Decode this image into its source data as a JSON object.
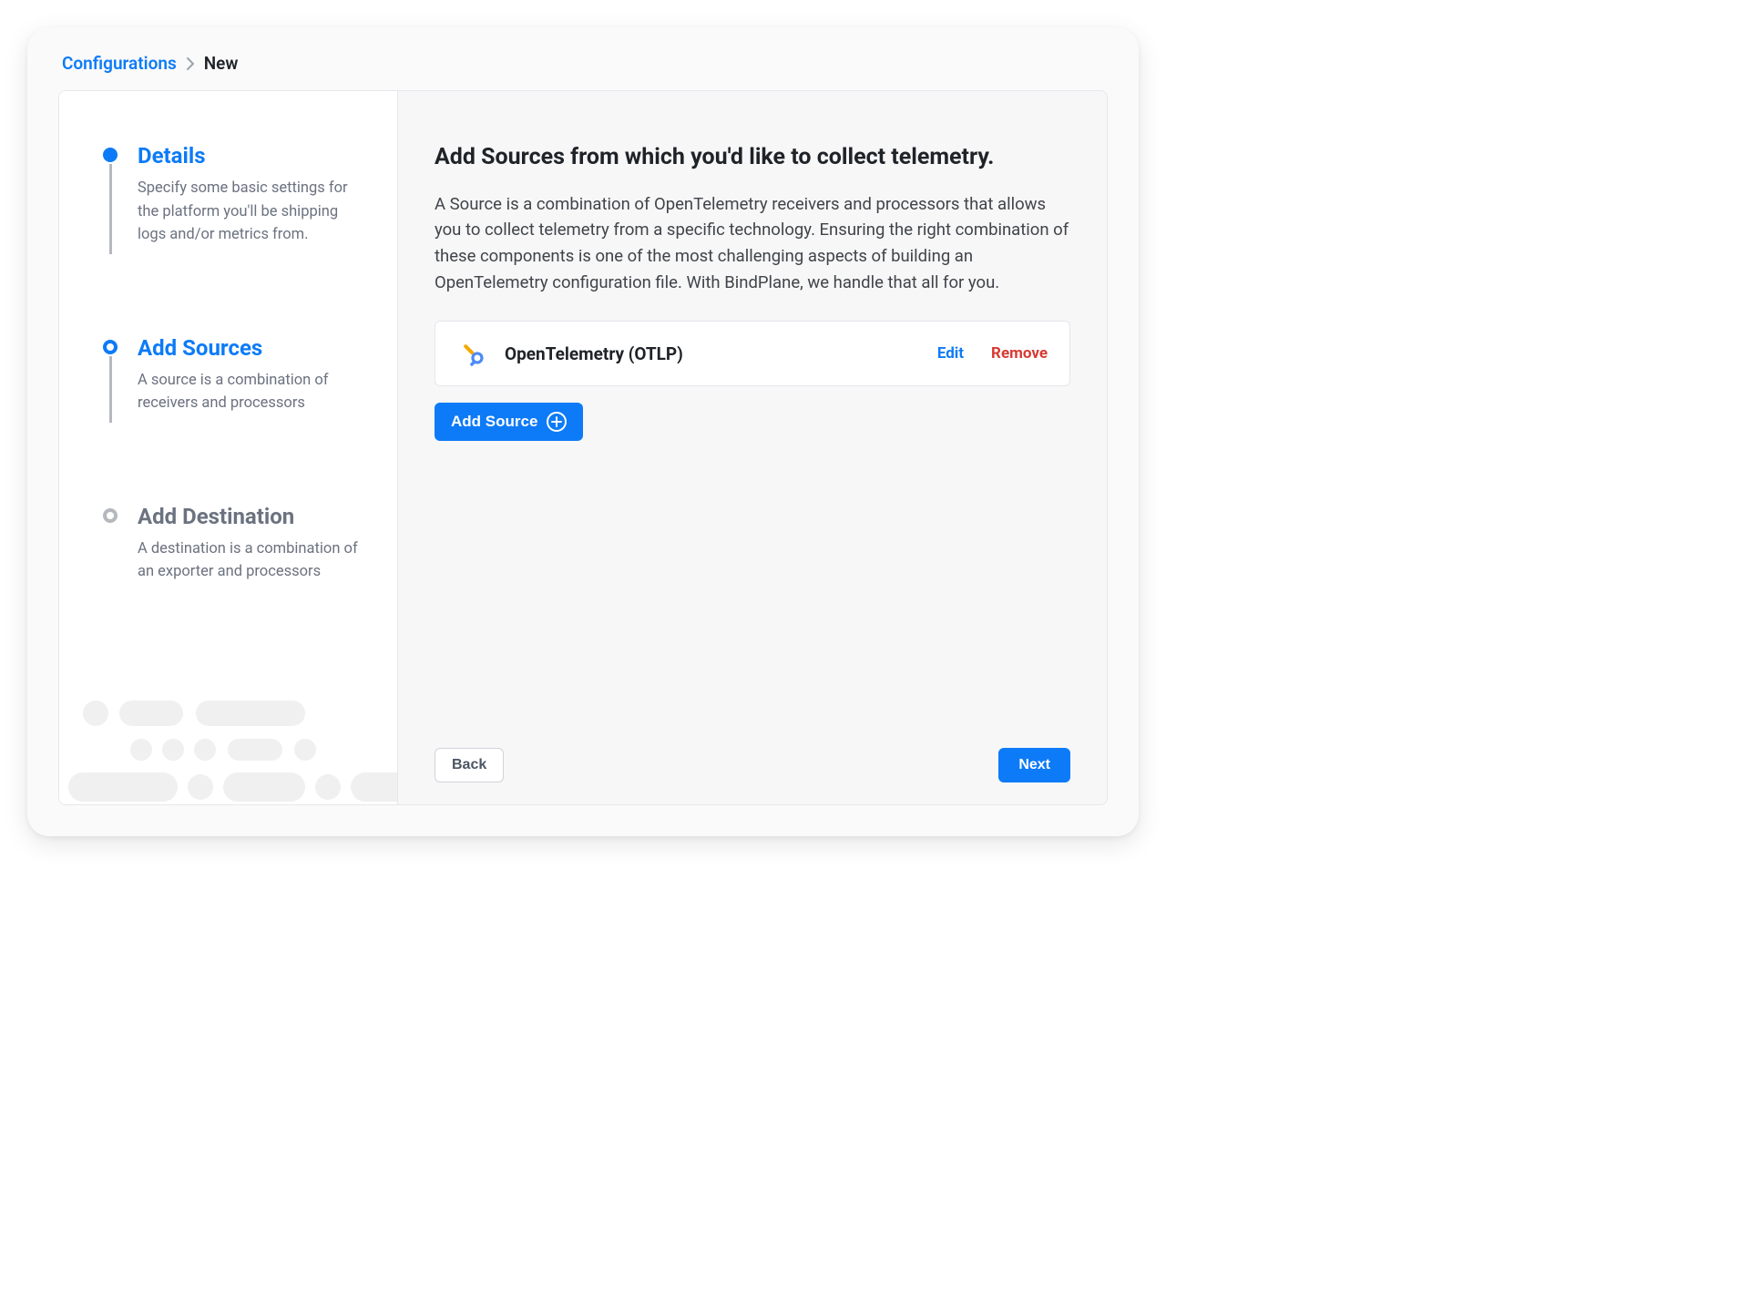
{
  "breadcrumbs": {
    "root": "Configurations",
    "current": "New"
  },
  "steps": [
    {
      "title": "Details",
      "desc": "Specify some basic settings for the platform you'll be shipping logs and/or metrics from.",
      "state": "complete"
    },
    {
      "title": "Add Sources",
      "desc": "A source is a combination of receivers and processors",
      "state": "current"
    },
    {
      "title": "Add Destination",
      "desc": "A destination is a combination of an exporter and processors",
      "state": "future"
    }
  ],
  "main": {
    "title": "Add Sources from which you'd like to collect telemetry.",
    "description": "A Source is a combination of OpenTelemetry receivers and processors that allows you to collect telemetry from a specific technology. Ensuring the right combination of these components is one of the most challenging aspects of building an OpenTelemetry configuration file. With BindPlane, we handle that all for you."
  },
  "sources": [
    {
      "name": "OpenTelemetry (OTLP)",
      "icon": "opentelemetry-icon",
      "edit_label": "Edit",
      "remove_label": "Remove"
    }
  ],
  "buttons": {
    "add_source": "Add Source",
    "back": "Back",
    "next": "Next"
  }
}
